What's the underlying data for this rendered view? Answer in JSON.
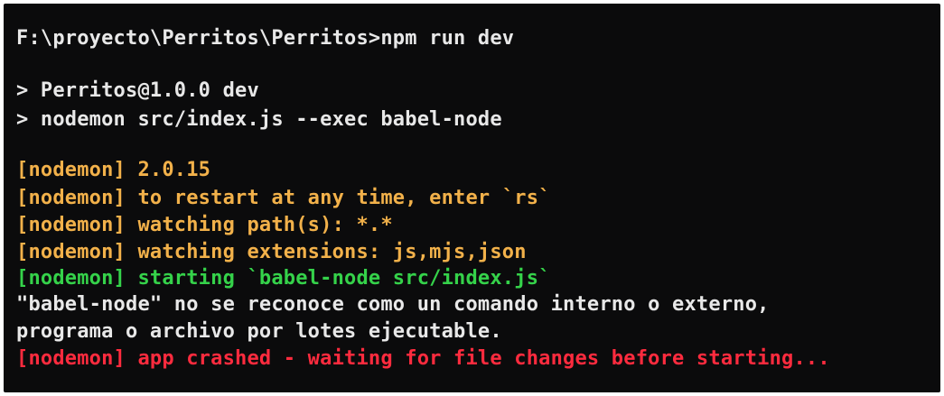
{
  "terminal": {
    "lines": [
      {
        "text": "F:\\proyecto\\Perritos\\Perritos>npm run dev",
        "color": "#e8e8e8"
      },
      {
        "text": "> Perritos@1.0.0 dev",
        "color": "#e8e8e8"
      },
      {
        "text": "> nodemon src/index.js --exec babel-node",
        "color": "#e8e8e8"
      },
      {
        "text": "[nodemon] 2.0.15",
        "color": "#f2b14a"
      },
      {
        "text": "[nodemon] to restart at any time, enter `rs`",
        "color": "#f2b14a"
      },
      {
        "text": "[nodemon] watching path(s): *.*",
        "color": "#f2b14a"
      },
      {
        "text": "[nodemon] watching extensions: js,mjs,json",
        "color": "#f2b14a"
      },
      {
        "text": "[nodemon] starting `babel-node src/index.js`",
        "color": "#35d24a"
      },
      {
        "text": "\"babel-node\" no se reconoce como un comando interno o externo,",
        "color": "#e8e8e8"
      },
      {
        "text": "programa o archivo por lotes ejecutable.",
        "color": "#e8e8e8"
      },
      {
        "text": "[nodemon] app crashed - waiting for file changes before starting...",
        "color": "#ff2b3e"
      }
    ]
  }
}
